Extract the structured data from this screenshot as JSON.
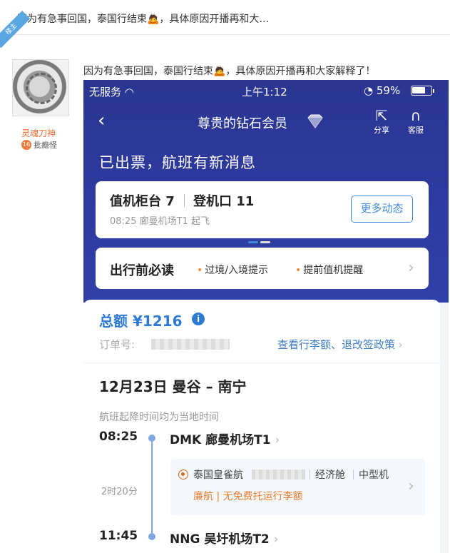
{
  "thread_title": "因为有急事回国，泰国行结束🙇，具体原因开播再和大…",
  "badge_label": "楼主",
  "user": {
    "name": "灵魂刀神",
    "level": "16",
    "rank": "批瘾怪"
  },
  "post_text": "因为有急事回国，泰国行结束🙇，具体原因开播再和大家解释了！",
  "phone": {
    "carrier": "无服务",
    "time": "上午1:12",
    "battery": "59%",
    "nav_title": "尊贵的钻石会员",
    "share_label": "分享",
    "service_label": "客服",
    "headline": "已出票，航班有新消息",
    "counter": "值机柜台 7",
    "gate": "登机口 11",
    "departure_note": "08:25 廊曼机场T1 起飞",
    "more_button": "更多动态",
    "must_read": "出行前必读",
    "tips": [
      "过境/入境提示",
      "提前值机提醒"
    ],
    "total_label": "总额 ¥1216",
    "order_label": "订单号:",
    "policy_link": "查看行李额、退改签政策",
    "route": "12月23日  曼谷 – 南宁",
    "tz_note": "航班起降时间均为当地时间",
    "depart_time": "08:25",
    "depart_airport": "DMK  廊曼机场T1",
    "duration": "2时20分",
    "airline": "泰国皇雀航",
    "cabin": "经济舱",
    "aircraft": "中型机",
    "low_cost": "廉航 | 无免费托运行李额",
    "arrive_time": "11:45",
    "arrive_airport": "NNG  吴圩机场T2"
  },
  "colors": {
    "nav_blue": "#2e3ba0",
    "accent_blue": "#2e7bd6",
    "orange": "#e67e2f"
  }
}
